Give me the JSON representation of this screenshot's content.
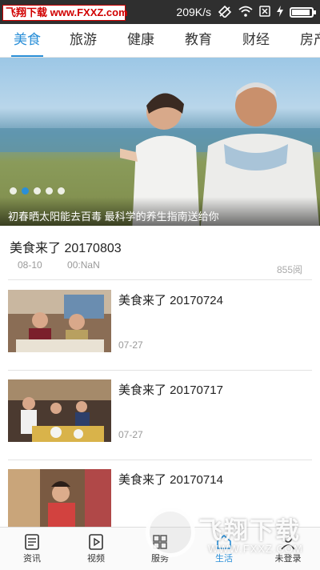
{
  "status_bar": {
    "watermark_text": "飞翔下载 www.FXXZ.com",
    "network_speed": "209K/s"
  },
  "tabs": [
    {
      "label": "美食",
      "active": true
    },
    {
      "label": "旅游",
      "active": false
    },
    {
      "label": "健康",
      "active": false
    },
    {
      "label": "教育",
      "active": false
    },
    {
      "label": "财经",
      "active": false
    },
    {
      "label": "房产",
      "active": false
    }
  ],
  "banner": {
    "caption": "初春晒太阳能去百毒 最科学的养生指南送给你",
    "dot_count": 5,
    "active_dot": 1
  },
  "headline": {
    "title": "美食来了 20170803",
    "date": "08-10",
    "time": "00:NaN",
    "views": "855阅"
  },
  "list": [
    {
      "title": "美食来了 20170724",
      "date": "07-27"
    },
    {
      "title": "美食来了 20170717",
      "date": "07-27"
    },
    {
      "title": "美食来了 20170714",
      "date": ""
    }
  ],
  "bottom_nav": [
    {
      "label": "资讯",
      "icon": "news-icon",
      "active": false
    },
    {
      "label": "视频",
      "icon": "video-icon",
      "active": false
    },
    {
      "label": "服务",
      "icon": "service-icon",
      "active": false
    },
    {
      "label": "生活",
      "icon": "life-icon",
      "active": true
    },
    {
      "label": "未登录",
      "icon": "user-icon",
      "active": false
    }
  ],
  "overlay_watermark": {
    "big_text": "飞翔下载",
    "url": "WWW.FXXZ.COM"
  },
  "colors": {
    "accent": "#2a8fd8",
    "status_bar": "#2f2f2f"
  }
}
